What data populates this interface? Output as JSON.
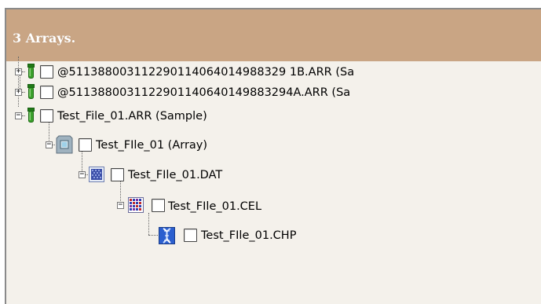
{
  "panel": {
    "title": "3 Arrays."
  },
  "tree": {
    "items": [
      {
        "label": "@511388003112290114064014988329 1B.ARR (Sa",
        "icon": "tube-icon",
        "expander": "+"
      },
      {
        "label": "@5113880031122901140640149883294A.ARR (Sa",
        "icon": "tube-icon",
        "expander": "+"
      },
      {
        "label": "Test_File_01.ARR (Sample)",
        "icon": "tube-icon",
        "expander": "−"
      },
      {
        "label": "Test_FIle_01 (Array)",
        "icon": "array-chip-icon",
        "expander": "−"
      },
      {
        "label": "Test_FIle_01.DAT",
        "icon": "dat-image-icon",
        "expander": "−"
      },
      {
        "label": "Test_FIle_01.CEL",
        "icon": "cel-grid-icon",
        "expander": "−"
      },
      {
        "label": "Test_FIle_01.CHP",
        "icon": "chp-dna-icon",
        "expander": ""
      }
    ]
  },
  "colors": {
    "header_bg": "#c9a584",
    "panel_bg": "#f4f1eb",
    "tube_green": "#3aa02b"
  }
}
